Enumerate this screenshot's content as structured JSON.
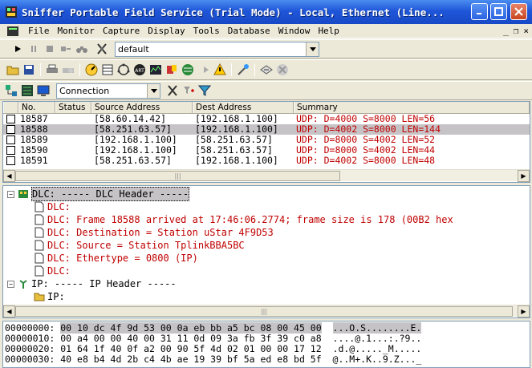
{
  "window": {
    "title": "Sniffer Portable Field Service (Trial Mode) - Local, Ethernet (Line..."
  },
  "menu": [
    "File",
    "Monitor",
    "Capture",
    "Display",
    "Tools",
    "Database",
    "Window",
    "Help"
  ],
  "mdi_controls": [
    "_",
    "❐",
    "×"
  ],
  "toolbar1": {
    "profile": "default"
  },
  "toolbar3": {
    "view": "Connection"
  },
  "packet_list": {
    "columns": [
      "No.",
      "Status",
      "Source Address",
      "Dest Address",
      "Summary"
    ],
    "rows": [
      {
        "no": "18587",
        "status": "",
        "src": "[58.60.14.42]",
        "dst": "[192.168.1.100]",
        "summary": "UDP: D=4000 S=8000   LEN=56"
      },
      {
        "no": "18588",
        "status": "",
        "src": "[58.251.63.57]",
        "dst": "[192.168.1.100]",
        "summary": "UDP: D=4002 S=8000   LEN=144",
        "selected": true
      },
      {
        "no": "18589",
        "status": "",
        "src": "[192.168.1.100]",
        "dst": "[58.251.63.57]",
        "summary": "UDP: D=8000 S=4002   LEN=52"
      },
      {
        "no": "18590",
        "status": "",
        "src": "[192.168.1.100]",
        "dst": "[58.251.63.57]",
        "summary": "UDP: D=8000 S=4002   LEN=44"
      },
      {
        "no": "18591",
        "status": "",
        "src": "[58.251.63.57]",
        "dst": "[192.168.1.100]",
        "summary": "UDP: D=4002 S=8000   LEN=48"
      }
    ]
  },
  "detail": {
    "dlc_header": "DLC:  ----- DLC Header -----",
    "lines": [
      "DLC:",
      "DLC:  Frame 18588 arrived at  17:46:06.2774; frame size is 178 (00B2 hex",
      "DLC:  Destination = Station uStar 4F9D53",
      "DLC:  Source      = Station TplinkBBA5BC",
      "DLC:  Ethertype   = 0800 (IP)",
      "DLC:"
    ],
    "ip_header": "IP: ----- IP Header -----",
    "ip_line": "IP:"
  },
  "hex": {
    "rows": [
      {
        "off": "00000000:",
        "bytes": "00 10 dc 4f 9d 53 00 0a eb bb a5 bc 08 00 45 00",
        "ascii": "...O.S........E."
      },
      {
        "off": "00000010:",
        "bytes": "00 a4 00 00 40 00 31 11 0d 09 3a fb 3f 39 c0 a8",
        "ascii": "....@.1...:.?9.."
      },
      {
        "off": "00000020:",
        "bytes": "01 64 1f 40 0f a2 00 90 5f 4d 02 01 00 00 17 12",
        "ascii": ".d.@....._M....."
      },
      {
        "off": "00000030:",
        "bytes": "40 e8 b4 4d 2b c4 4b ae 19 39 bf 5a ed e8 bd 5f",
        "ascii": "@..M+.K..9.Z..._"
      }
    ]
  }
}
